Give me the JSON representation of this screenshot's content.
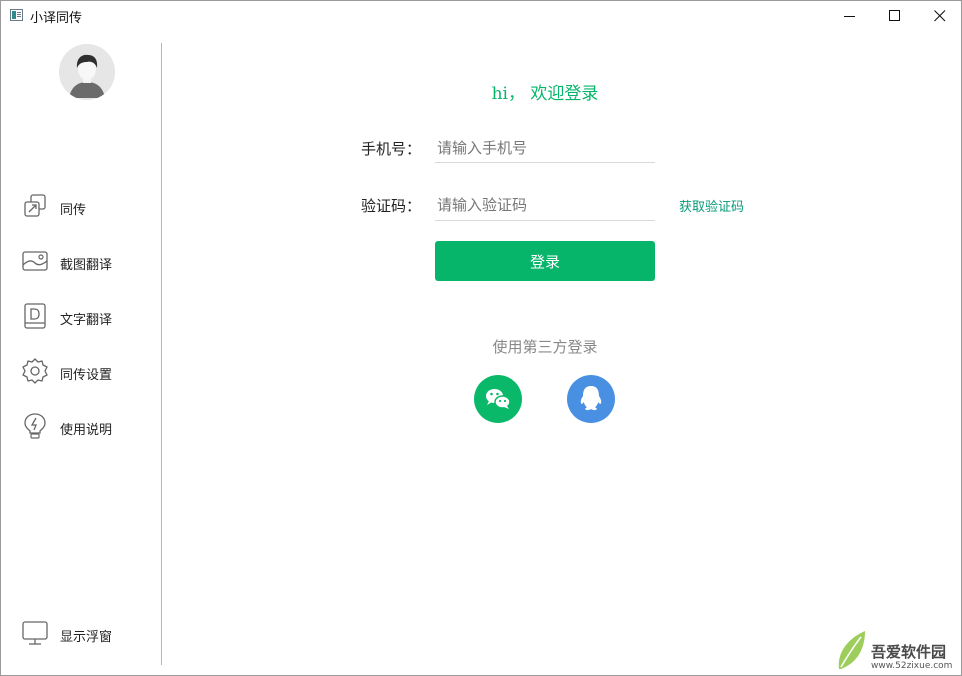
{
  "window": {
    "title": "小译同传"
  },
  "sidebar": {
    "items": [
      {
        "label": "同传",
        "icon": "simultaneous-icon"
      },
      {
        "label": "截图翻译",
        "icon": "screenshot-icon"
      },
      {
        "label": "文字翻译",
        "icon": "document-icon"
      },
      {
        "label": "同传设置",
        "icon": "gear-icon"
      },
      {
        "label": "使用说明",
        "icon": "lightbulb-icon"
      }
    ],
    "bottom_item": {
      "label": "显示浮窗",
      "icon": "monitor-icon"
    }
  },
  "login": {
    "welcome": "hi， 欢迎登录",
    "phone_label": "手机号：",
    "phone_placeholder": "请输入手机号",
    "code_label": "验证码：",
    "code_placeholder": "请输入验证码",
    "get_code": "获取验证码",
    "submit": "登录",
    "third_party": "使用第三方登录"
  },
  "watermark": {
    "brand": "吾爱软件园",
    "url": "www.52zixue.com"
  },
  "colors": {
    "accent": "#07b56a",
    "qq": "#4a90e2",
    "link": "#0a9a7a"
  }
}
